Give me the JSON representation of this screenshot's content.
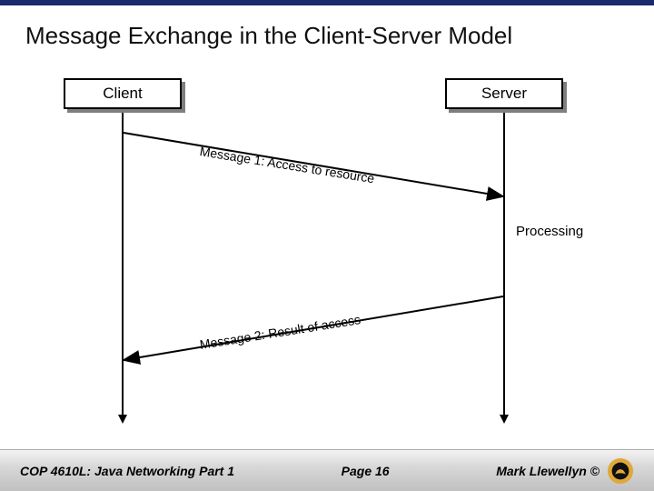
{
  "title": "Message Exchange in the Client-Server Model",
  "diagram": {
    "client_label": "Client",
    "server_label": "Server",
    "message1": "Message 1: Access to resource",
    "message2": "Message 2: Result of access",
    "processing": "Processing"
  },
  "footer": {
    "course": "COP 4610L: Java Networking Part 1",
    "page": "Page 16",
    "author": "Mark Llewellyn ©"
  },
  "colors": {
    "accent_bar": "#1a2a6c",
    "logo_gold": "#e0a83a",
    "logo_dark": "#111"
  }
}
